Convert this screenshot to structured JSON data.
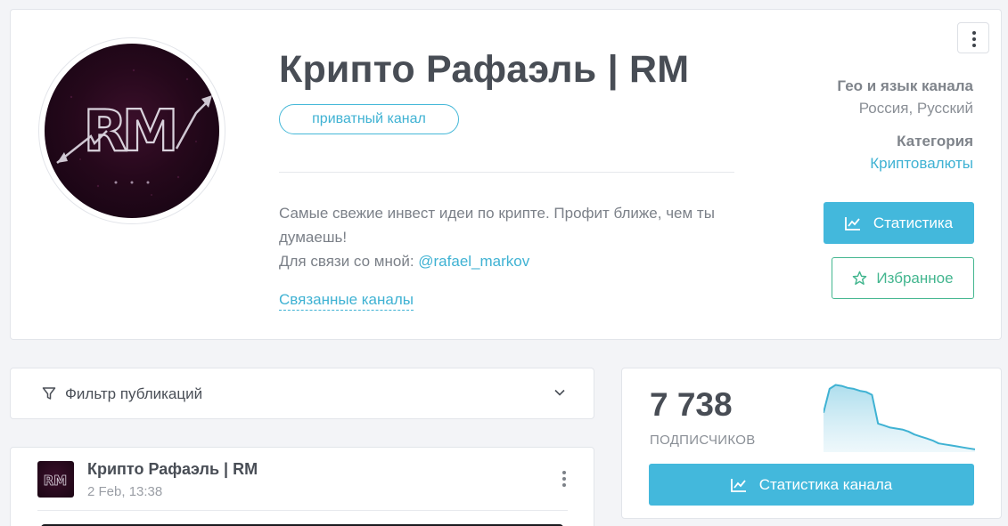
{
  "channel": {
    "title": "Крипто Рафаэль | RM",
    "badge": "приватный канал",
    "description_line1": "Самые свежие инвест идеи по крипте. Профит ближе, чем ты думаешь!",
    "description_contact_prefix": "Для связи со мной: ",
    "description_contact_link": "@rafael_markov",
    "related_channels": "Связанные каналы",
    "avatar_text": "RM"
  },
  "meta": {
    "geo_label": "Гео и язык канала",
    "geo_value": "Россия, Русский",
    "category_label": "Категория",
    "category_value": "Криптовалюты"
  },
  "actions": {
    "stats_label": "Статистика",
    "favorite_label": "Избранное"
  },
  "filter": {
    "label": "Фильтр публикаций"
  },
  "post": {
    "author": "Крипто Рафаэль | RM",
    "date": "2 Feb, 13:38"
  },
  "stats": {
    "subscribers": "7 738",
    "subscribers_label": "ПОДПИСЧИКОВ",
    "channel_stats_label": "Статистика канала"
  },
  "chart_data": {
    "type": "area",
    "title": "",
    "xlabel": "",
    "ylabel": "",
    "values": [
      38,
      62,
      66,
      65,
      63,
      62,
      60,
      59,
      56,
      27,
      25,
      23,
      22,
      21,
      19,
      16,
      14,
      12,
      10,
      7,
      6,
      5,
      4,
      3,
      2,
      1
    ],
    "ylim": [
      0,
      70
    ],
    "grid": false,
    "color": "#3fb2d3"
  },
  "colors": {
    "accent": "#43b8dc",
    "favorite": "#43b68f",
    "text": "#484d55"
  },
  "icons": {
    "stats": "chart-line-icon",
    "favorite": "star-icon",
    "filter": "filter-icon",
    "more": "more-vertical-icon",
    "chevron": "chevron-down-icon"
  }
}
